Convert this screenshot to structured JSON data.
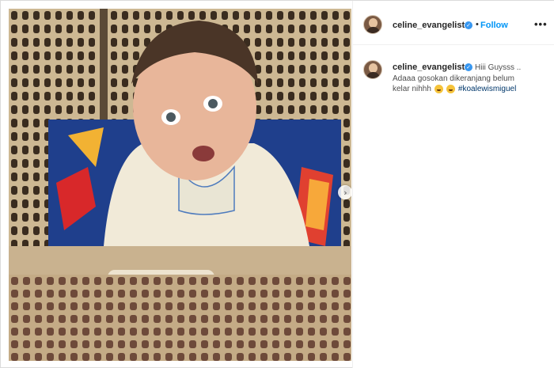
{
  "post": {
    "username": "celine_evangelista",
    "follow_label": "Follow",
    "separator": "•",
    "more_label": "•••",
    "verified_mark": "✓"
  },
  "caption": {
    "username": "celine_evangelista",
    "line1": "Hiii Guysss ..",
    "line2": "Adaaa gosokan dikeranjang belum",
    "line3": "kelar nihhh",
    "emojis": [
      "grinning-squint-face",
      "laughing-face"
    ],
    "hashtag": "#koalewismiguel"
  },
  "carousel": {
    "next_icon": "›",
    "slides": 2,
    "active_slide": 1
  },
  "colors": {
    "accent": "#0095f6",
    "verified": "#3897f0",
    "hashtag": "#00376b",
    "basket": "#c9b28f"
  }
}
